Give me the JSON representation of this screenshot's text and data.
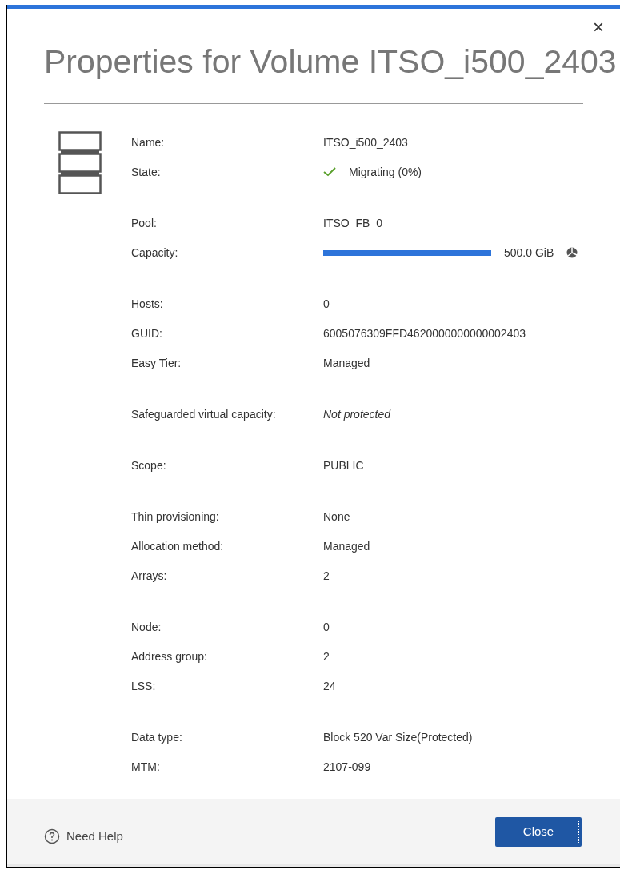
{
  "dialog": {
    "title": "Properties for Volume ITSO_i500_2403",
    "close": "×"
  },
  "groups": [
    [
      {
        "label": "Name:",
        "kind": "text",
        "value": "ITSO_i500_2403"
      },
      {
        "label": "State:",
        "kind": "status",
        "value": "Migrating (0%)"
      }
    ],
    [
      {
        "label": "Pool:",
        "kind": "text",
        "value": "ITSO_FB_0"
      },
      {
        "label": "Capacity:",
        "kind": "bar",
        "level": 1,
        "value": "500.0 GiB"
      }
    ],
    [
      {
        "label": "Hosts:",
        "kind": "text",
        "value": "0"
      },
      {
        "label": "GUID:",
        "kind": "text",
        "value": "6005076309FFD4620000000000002403"
      },
      {
        "label": "Easy Tier:",
        "kind": "text",
        "value": "Managed"
      }
    ],
    [
      {
        "label": "Safeguarded virtual capacity:",
        "kind": "italic",
        "value": "Not protected"
      }
    ],
    [
      {
        "label": "Scope:",
        "kind": "text",
        "value": "PUBLIC"
      }
    ],
    [
      {
        "label": "Thin provisioning:",
        "kind": "text",
        "value": "None"
      },
      {
        "label": "Allocation method:",
        "kind": "text",
        "value": "Managed"
      },
      {
        "label": "Arrays:",
        "kind": "text",
        "value": "2"
      }
    ],
    [
      {
        "label": "Node:",
        "kind": "text",
        "value": "0"
      },
      {
        "label": "Address group:",
        "kind": "text",
        "value": "2"
      },
      {
        "label": "LSS:",
        "kind": "text",
        "value": "24"
      }
    ],
    [
      {
        "label": "Data type:",
        "kind": "text",
        "value": "Block 520 Var Size(Protected)"
      },
      {
        "label": "MTM:",
        "kind": "text",
        "value": "2107-099"
      }
    ]
  ],
  "footer": {
    "help": "Need Help",
    "button": "Close"
  }
}
